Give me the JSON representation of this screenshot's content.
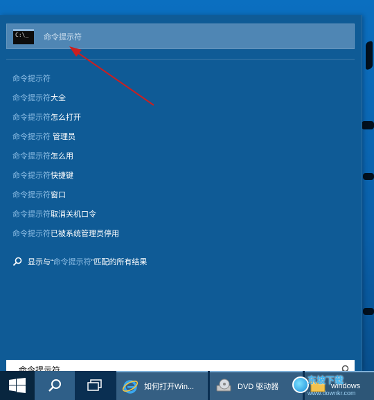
{
  "search_panel": {
    "top_result": {
      "icon_text": "C:\\_",
      "label": "命令提示符"
    },
    "results": [
      {
        "highlight": "命令提示符",
        "suffix": ""
      },
      {
        "highlight": "命令提示符",
        "suffix": "大全"
      },
      {
        "highlight": "命令提示符",
        "suffix": "怎么打开"
      },
      {
        "highlight": "命令提示符",
        "suffix": " 管理员"
      },
      {
        "highlight": "命令提示符",
        "suffix": "怎么用"
      },
      {
        "highlight": "命令提示符",
        "suffix": "快捷键"
      },
      {
        "highlight": "命令提示符",
        "suffix": "窗口"
      },
      {
        "highlight": "命令提示符",
        "suffix": "取消关机口令"
      },
      {
        "highlight": "命令提示符",
        "suffix": "已被系统管理员停用"
      }
    ],
    "search_all": {
      "prefix": "显示与“",
      "highlight": "命令提示符",
      "suffix": "”匹配的所有结果"
    },
    "query": "命令提示符"
  },
  "taskbar": {
    "ie_label": "如何打开Win...",
    "dvd_label": "DVD 驱动器",
    "win_label": "windows"
  },
  "watermark": {
    "text": "东坡下载",
    "url": "www.downkr.com"
  },
  "colors": {
    "panel": "#0f5b96",
    "highlight_text": "#8fbfe6",
    "taskbar": "#0a2f52",
    "annotation_arrow": "#cc1f1f"
  }
}
